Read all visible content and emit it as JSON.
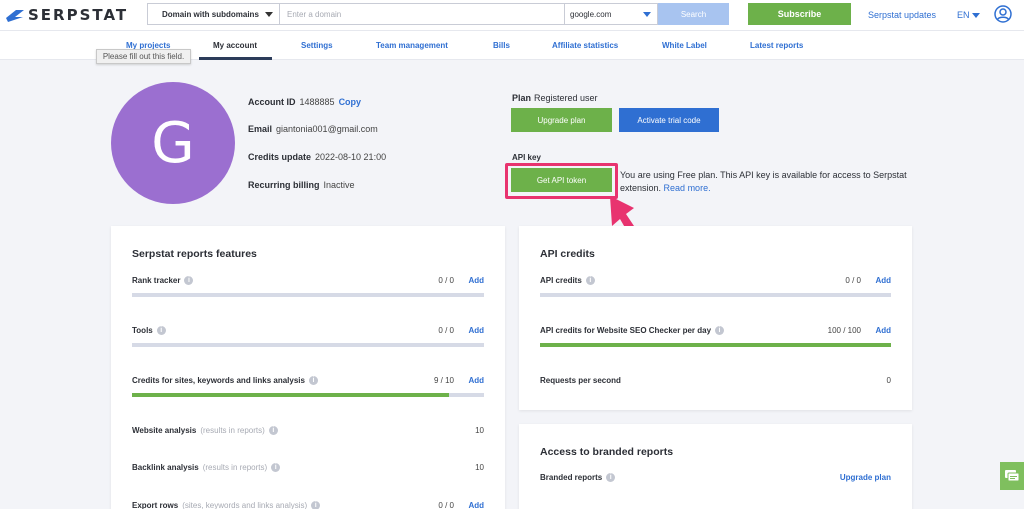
{
  "header": {
    "logo": "SERPSTAT",
    "domain_mode": "Domain with subdomains",
    "domain_placeholder": "Enter a domain",
    "engine": "google.com",
    "search_label": "Search",
    "subscribe_label": "Subscribe",
    "updates_label": "Serpstat updates",
    "language": "EN"
  },
  "nav": {
    "items": [
      "My projects",
      "My account",
      "Settings",
      "Team management",
      "Bills",
      "Affiliate statistics",
      "White Label",
      "Latest reports"
    ],
    "active": "My account",
    "tooltip": "Please fill out this field."
  },
  "profile": {
    "avatar_letter": "G",
    "account_id_label": "Account ID",
    "account_id": "1488885",
    "copy_label": "Copy",
    "email_label": "Email",
    "email": "giantonia001@gmail.com",
    "credits_update_label": "Credits update",
    "credits_update": "2022-08-10 21:00",
    "billing_label": "Recurring billing",
    "billing": "Inactive"
  },
  "plan": {
    "label": "Plan",
    "value": "Registered user",
    "upgrade_label": "Upgrade plan",
    "trial_label": "Activate trial code",
    "api_key_label": "API key",
    "get_token_label": "Get API token",
    "api_desc": "You are using Free plan. This API key is available for access to Serpstat extension.",
    "read_more": "Read more."
  },
  "features": {
    "title": "Serpstat reports features",
    "rows": [
      {
        "label": "Rank tracker",
        "value": "0 / 0",
        "add": "Add",
        "fill": 0
      },
      {
        "label": "Tools",
        "value": "0 / 0",
        "add": "Add",
        "fill": 0
      },
      {
        "label": "Credits for sites, keywords and links analysis",
        "value": "9 / 10",
        "add": "Add",
        "fill": 0.9
      },
      {
        "label": "Website analysis",
        "hint": "(results in reports)",
        "value": "10"
      },
      {
        "label": "Backlink analysis",
        "hint": "(results in reports)",
        "value": "10"
      },
      {
        "label": "Export rows",
        "hint": "(sites, keywords and links analysis)",
        "value": "0 / 0",
        "add": "Add"
      }
    ]
  },
  "api_credits": {
    "title": "API credits",
    "rows": [
      {
        "label": "API credits",
        "value": "0 / 0",
        "add": "Add",
        "fill": 0
      },
      {
        "label": "API credits for Website SEO Checker per day",
        "value": "100 / 100",
        "add": "Add",
        "fill": 1.0
      },
      {
        "label": "Requests per second",
        "value": "0"
      }
    ]
  },
  "branded": {
    "title": "Access to branded reports",
    "row_label": "Branded reports",
    "upgrade_label": "Upgrade plan"
  },
  "colors": {
    "green": "#6db14a",
    "blue": "#2f6fd2",
    "highlight": "#e8336f",
    "avatar": "#9b6fd0"
  }
}
